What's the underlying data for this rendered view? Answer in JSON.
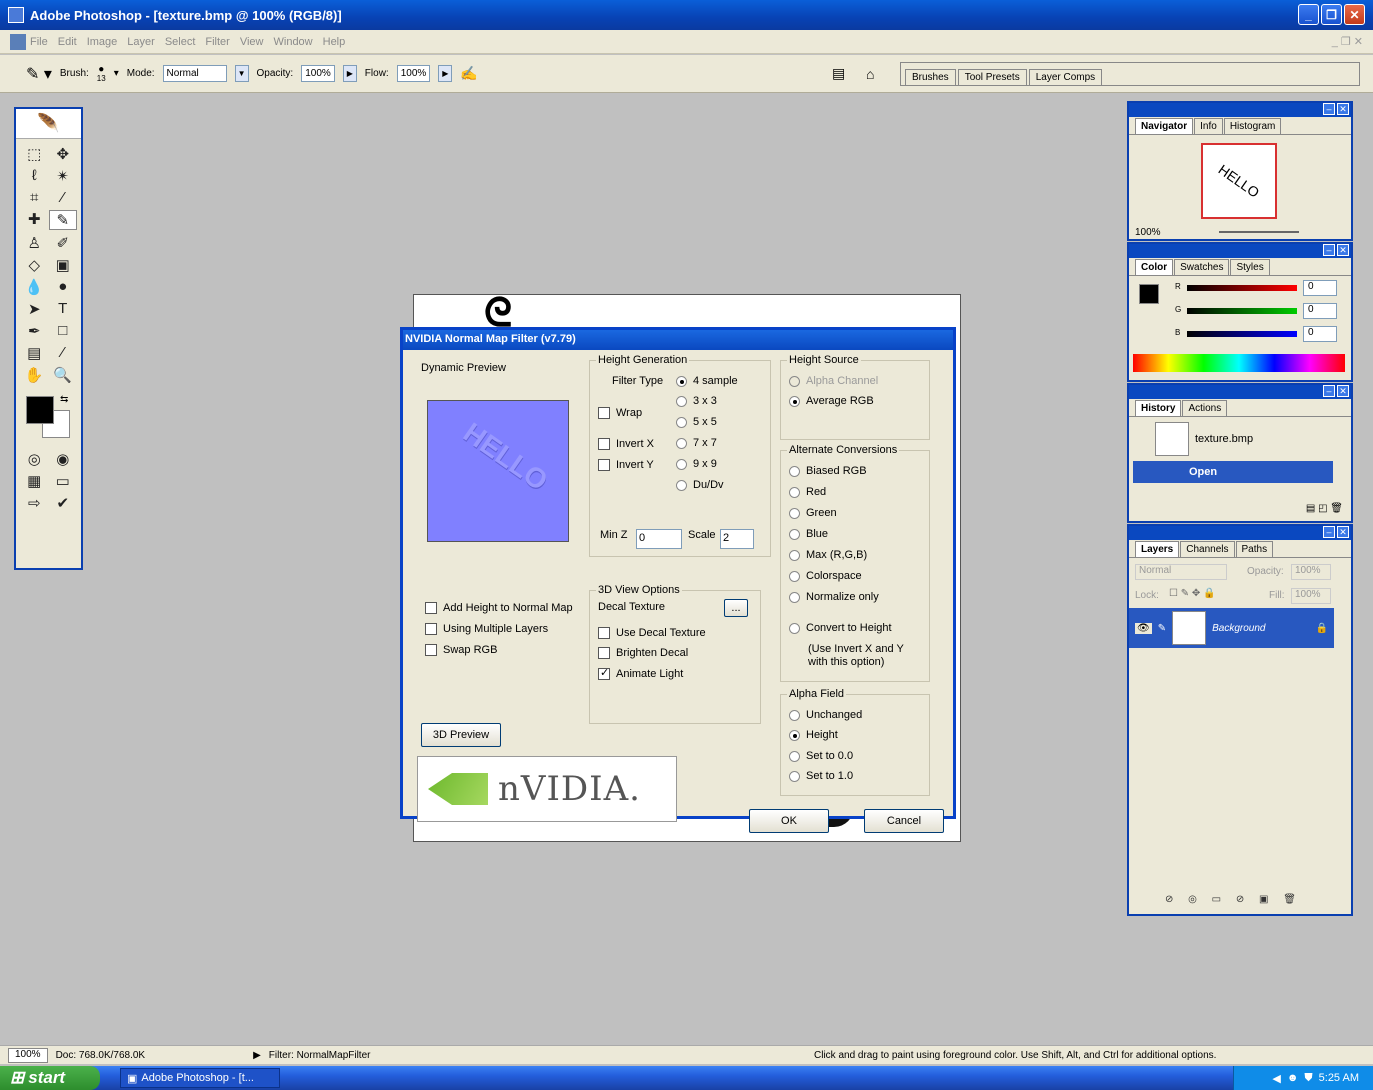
{
  "window": {
    "title": "Adobe Photoshop - [texture.bmp @ 100% (RGB/8)]"
  },
  "menu": [
    "File",
    "Edit",
    "Image",
    "Layer",
    "Select",
    "Filter",
    "View",
    "Window",
    "Help"
  ],
  "options": {
    "brush_label": "Brush:",
    "brush_size": "13",
    "mode_label": "Mode:",
    "mode_value": "Normal",
    "opacity_label": "Opacity:",
    "opacity_value": "100%",
    "flow_label": "Flow:",
    "flow_value": "100%",
    "well_tabs": [
      "Brushes",
      "Tool Presets",
      "Layer Comps"
    ]
  },
  "dialog": {
    "title": "NVIDIA Normal Map Filter (v7.79)",
    "dynamic_preview": "Dynamic Preview",
    "preview_text": "HELLO",
    "height_generation": "Height Generation",
    "filter_type": "Filter Type",
    "filter_options": [
      "4 sample",
      "3 x 3",
      "5 x 5",
      "7 x 7",
      "9 x 9",
      "Du/Dv"
    ],
    "wrap": "Wrap",
    "invert_x": "Invert X",
    "invert_y": "Invert Y",
    "min_z_label": "Min Z",
    "min_z_value": "0",
    "scale_label": "Scale",
    "scale_value": "2",
    "height_source": "Height Source",
    "alpha_channel": "Alpha Channel",
    "average_rgb": "Average RGB",
    "alternate_conversions": "Alternate Conversions",
    "conversions": [
      "Biased RGB",
      "Red",
      "Green",
      "Blue",
      "Max (R,G,B)",
      "Colorspace",
      "Normalize only"
    ],
    "convert_to_height": "Convert to Height",
    "convert_note": "(Use Invert X and Y\nwith this option)",
    "add_height": "Add Height to Normal Map",
    "multiple_layers": "Using Multiple Layers",
    "swap_rgb": "Swap RGB",
    "view_options": "3D View Options",
    "decal_texture": "Decal Texture",
    "browse": "...",
    "use_decal": "Use Decal Texture",
    "brighten_decal": "Brighten Decal",
    "animate_light": "Animate Light",
    "alpha_field": "Alpha Field",
    "alpha_options": [
      "Unchanged",
      "Height",
      "Set to 0.0",
      "Set to 1.0"
    ],
    "preview_3d": "3D Preview",
    "ok": "OK",
    "cancel": "Cancel",
    "logo": "nVIDIA."
  },
  "navigator": {
    "tabs": [
      "Navigator",
      "Info",
      "Histogram"
    ],
    "zoom": "100%",
    "thumb_text": "HELLO"
  },
  "color": {
    "tabs": [
      "Color",
      "Swatches",
      "Styles"
    ],
    "r": "0",
    "g": "0",
    "b": "0"
  },
  "history": {
    "tabs": [
      "History",
      "Actions"
    ],
    "snapshot": "texture.bmp",
    "state": "Open"
  },
  "layers": {
    "tabs": [
      "Layers",
      "Channels",
      "Paths"
    ],
    "blend": "Normal",
    "opacity_label": "Opacity:",
    "opacity": "100%",
    "lock_label": "Lock:",
    "fill_label": "Fill:",
    "fill": "100%",
    "layer_name": "Background"
  },
  "status": {
    "zoom": "100%",
    "doc": "Doc: 768.0K/768.0K",
    "filter": "Filter: NormalMapFilter",
    "hint": "Click and drag to paint using foreground color.  Use Shift, Alt, and Ctrl for additional options."
  },
  "taskbar": {
    "start": "start",
    "task": "Adobe Photoshop - [t...",
    "time": "5:25 AM"
  }
}
